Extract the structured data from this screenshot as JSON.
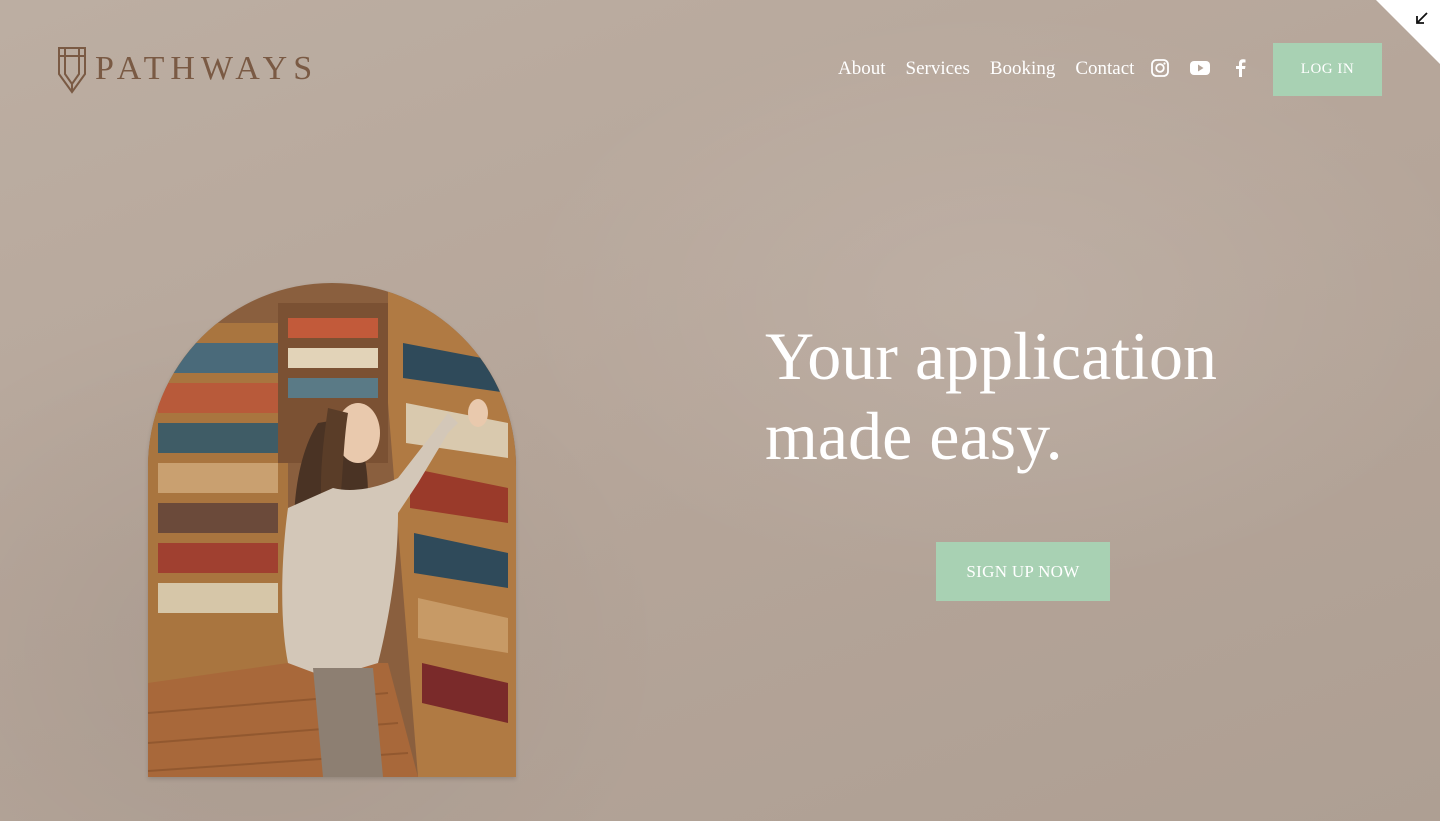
{
  "brand": {
    "name": "PATHWAYS",
    "logo_icon": "pencil-crest-icon",
    "color": "#7a5a44"
  },
  "nav": {
    "links": [
      "About",
      "Services",
      "Booking",
      "Contact"
    ],
    "social": [
      "instagram-icon",
      "youtube-icon",
      "facebook-icon"
    ],
    "login_label": "LOG IN"
  },
  "hero": {
    "headline": "Your application made easy.",
    "cta_label": "SIGN UP NOW",
    "image": "woman-browsing-bookshelf-photo"
  },
  "colors": {
    "background": "#b7a89c",
    "accent": "#a8d1b3",
    "text": "#ffffff"
  },
  "corner_icon": "collapse-arrow-icon"
}
